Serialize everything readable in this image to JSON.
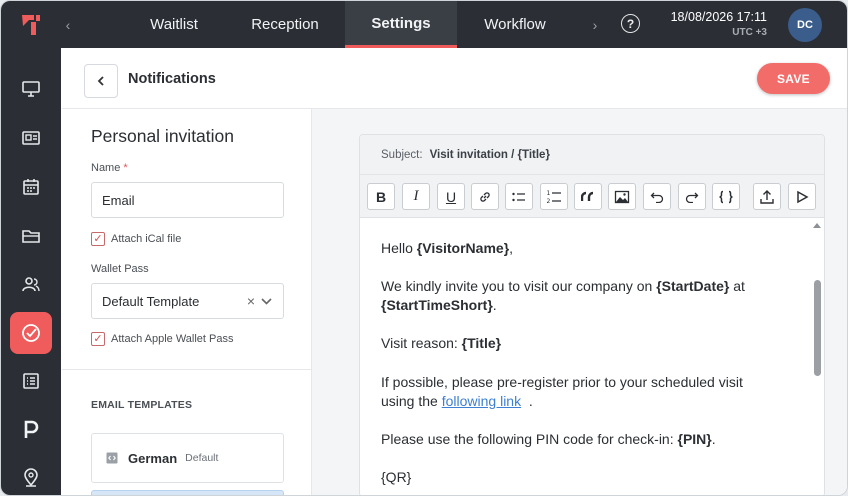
{
  "topbar": {
    "tabs": [
      "Waitlist",
      "Reception",
      "Settings",
      "Workflow"
    ],
    "active_tab": "Settings",
    "help_label": "?",
    "date": "18/08/2026 17:11",
    "timezone": "UTC +3",
    "avatar_initials": "DC"
  },
  "header": {
    "title": "Notifications",
    "save_label": "SAVE"
  },
  "left": {
    "section_title": "Personal invitation",
    "name_label": "Name",
    "name_required": "*",
    "name_value": "Email",
    "attach_ical_label": "Attach iCal file",
    "wallet_pass_label": "Wallet Pass",
    "wallet_pass_value": "Default Template",
    "attach_wallet_label": "Attach Apple Wallet Pass",
    "email_templates_label": "EMAIL TEMPLATES",
    "templates": [
      {
        "name": "German",
        "tag": "Default"
      }
    ]
  },
  "editor": {
    "subject_label": "Subject:",
    "subject_value": "Visit invitation / {Title}",
    "body": {
      "p1_pre": "Hello ",
      "p1_var": "{VisitorName}",
      "p1_post": ",",
      "p2_pre": "We kindly invite you to visit our company on ",
      "p2_var1": "{StartDate}",
      "p2_mid": " at",
      "p2_var2": "{StartTimeShort}",
      "p2_post": ".",
      "p3_pre": "Visit reason: ",
      "p3_var": "{Title}",
      "p4_line1": "If possible, please pre-register prior to your scheduled visit",
      "p4_pre": "using the ",
      "p4_link": "following link",
      "p4_post": "  .",
      "p5_pre": "Please use the following PIN code for check-in: ",
      "p5_var": "{PIN}",
      "p5_post": ".",
      "p6": "{QR}"
    }
  },
  "colors": {
    "accent": "#f05b5b",
    "topbar_bg": "#2b2f35",
    "avatar_bg": "#3b5d8c",
    "link": "#3e7fd1"
  }
}
